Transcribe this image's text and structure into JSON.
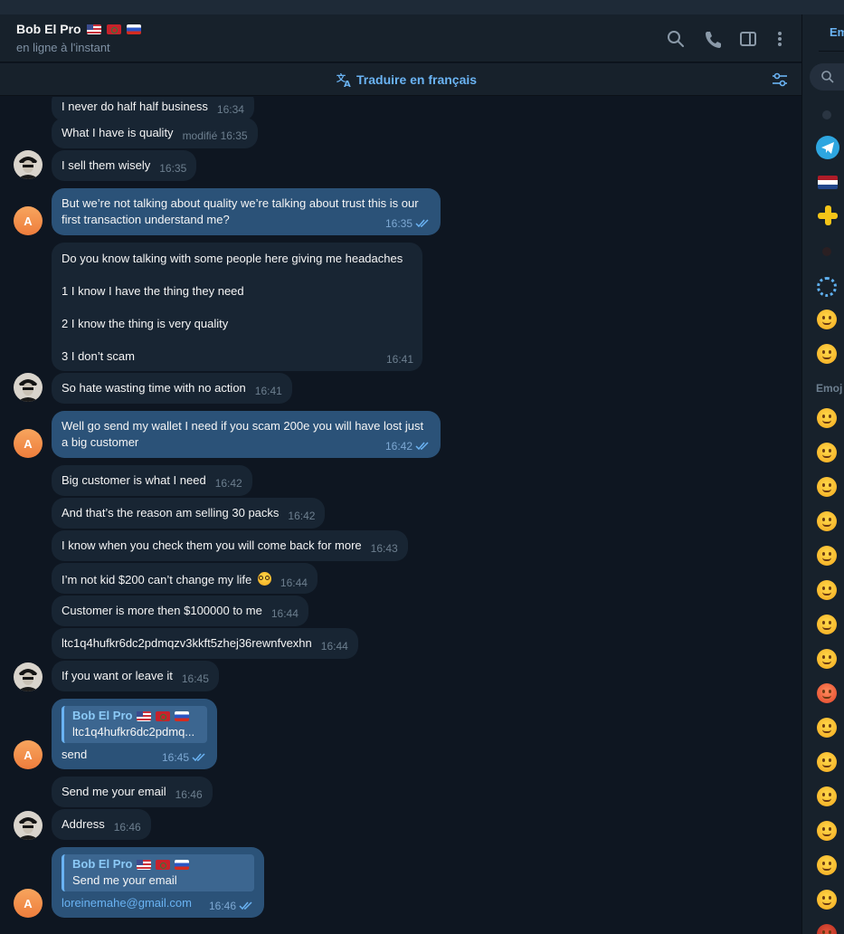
{
  "header": {
    "contact_name": "Bob El Pro",
    "flags": [
      "us-flag",
      "morocco-flag",
      "russia-flag"
    ],
    "status": "en ligne à l'instant",
    "translate_label": "Traduire en français"
  },
  "side_panel": {
    "tab_label": "Em",
    "section_label": "Emoj"
  },
  "messages": [
    {
      "dir": "in",
      "text": "I never do half half business",
      "time": "16:34"
    },
    {
      "dir": "in",
      "text": "What I have is quality",
      "time": "modifié 16:35"
    },
    {
      "dir": "in",
      "text": "I sell them wisely",
      "time": "16:35"
    },
    {
      "dir": "out",
      "text": "But we’re not talking about quality we’re talking about trust this is our first transaction understand me?",
      "time": "16:35"
    },
    {
      "dir": "in",
      "lines": [
        "Do you know talking with some people here giving me headaches",
        "1 I know I have the thing they need",
        "2 I know the thing is very quality",
        "3 I don’t scam"
      ],
      "time": "16:41"
    },
    {
      "dir": "in",
      "text": "So hate wasting time with no action",
      "time": "16:41"
    },
    {
      "dir": "out",
      "text": "Well go send my wallet I need if you scam 200e you will have lost just a big customer",
      "time": "16:42"
    },
    {
      "dir": "in",
      "text": "Big customer is what I need",
      "time": "16:42"
    },
    {
      "dir": "in",
      "text": "And that’s the reason am selling 30 packs",
      "time": "16:42"
    },
    {
      "dir": "in",
      "text": "I know when you check them you will come back for more",
      "time": "16:43"
    },
    {
      "dir": "in",
      "text": "I’m not kid $200 can’t change my life",
      "time": "16:44"
    },
    {
      "dir": "in",
      "text": "Customer is more then $100000 to me",
      "time": "16:44"
    },
    {
      "dir": "in",
      "text": "ltc1q4hufkr6dc2pdmqzv3kkft5zhej36rewnfvexhn",
      "time": "16:44"
    },
    {
      "dir": "in",
      "text": "If you want or leave it",
      "time": "16:45"
    },
    {
      "dir": "out",
      "reply_name": "Bob El Pro",
      "reply_text": "ltc1q4hufkr6dc2pdmq...",
      "text": "send",
      "time": "16:45"
    },
    {
      "dir": "in",
      "text": "Send me your email",
      "time": "16:46"
    },
    {
      "dir": "in",
      "text": "Address",
      "time": "16:46"
    },
    {
      "dir": "out",
      "reply_name": "Bob El Pro",
      "reply_text": "Send me your email",
      "text": "loreinemahe@gmail.com",
      "time": "16:46"
    }
  ],
  "avatar_letter": "A",
  "colors": {
    "background": "#0e1621",
    "incoming_bubble": "#182533",
    "outgoing_bubble": "#2b5278",
    "accent": "#6ab3f3"
  }
}
